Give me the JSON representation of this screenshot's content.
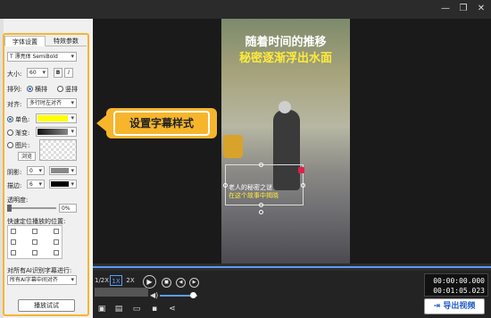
{
  "titlebar": {
    "min_icon": "minimize-icon",
    "restore_icon": "restore-icon",
    "close_icon": "close-icon"
  },
  "panel": {
    "tabs": [
      "字体设置",
      "特效参数"
    ],
    "font_name": "T 漂亮体 SemiBold",
    "size_label": "大小:",
    "size_value": "60",
    "bold": "B",
    "italic": "I",
    "layout_label": "排列:",
    "layout_horizontal": "横排",
    "layout_vertical": "竖排",
    "align_label": "对齐:",
    "align_value": "多行时左对齐",
    "solid_label": "单色:",
    "solid_color": "#ffff00",
    "gradient_label": "渐变:",
    "image_label": "图片:",
    "browse": "浏览",
    "shadow_label": "阴影:",
    "shadow_value": "0",
    "stroke_label": "描边:",
    "stroke_value": "6",
    "opacity_label": "透明度:",
    "opacity_value": "0%",
    "quick_pos_label": "快速定位播放的位置:",
    "ai_label": "对所有AI识别字幕进行:",
    "ai_value": "所有AI字幕中间对齐",
    "preview_button": "播放试试"
  },
  "video": {
    "title_line1": "随着时间的推移",
    "title_line2": "秘密逐渐浮出水面",
    "subtitle_line1": "老人的秘密之谜",
    "subtitle_line2": "在这个故事中揭晓"
  },
  "callout": {
    "text": "设置字幕样式"
  },
  "player": {
    "speeds": [
      "1/2X",
      "1X",
      "2X"
    ],
    "time_current": "00:00:00.000",
    "time_total": "00:01:05.023",
    "volume_level": 0.8
  },
  "export": {
    "label": "导出视频"
  },
  "colors": {
    "accent": "#f7b52c",
    "highlight": "#ffff00",
    "progress": "#5c9cf5"
  }
}
